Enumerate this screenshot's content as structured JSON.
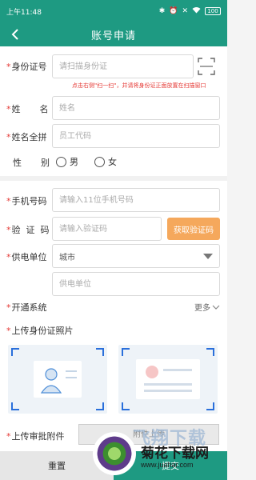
{
  "status_bar": {
    "time": "上午11:48",
    "battery": "100"
  },
  "nav": {
    "title": "账号申请"
  },
  "form": {
    "id_number": {
      "label": "身份证号",
      "placeholder": "请扫描身份证"
    },
    "scan_hint": "点击右侧\"扫一扫\"，并请将身份证正面放置在扫描窗口",
    "name": {
      "label_a": "姓",
      "label_b": "名",
      "placeholder": "姓名"
    },
    "pinyin": {
      "label": "姓名全拼",
      "placeholder": "员工代码"
    },
    "gender": {
      "label_a": "性",
      "label_b": "别",
      "options": [
        "男",
        "女"
      ]
    },
    "phone": {
      "label": "手机号码",
      "placeholder": "请输入11位手机号码"
    },
    "code": {
      "label_a": "验",
      "label_b": "证",
      "label_c": "码",
      "placeholder": "请输入验证码",
      "button": "获取验证码"
    },
    "supply_unit": {
      "label": "供电单位",
      "city_value": "城市",
      "unit_placeholder": "供电单位"
    },
    "systems": {
      "label": "开通系统",
      "more": "更多"
    },
    "id_photo": {
      "label": "上传身份证照片"
    },
    "approval": {
      "label": "上传审批附件",
      "button": "附件上传"
    }
  },
  "bottom": {
    "reset": "重置",
    "submit": "提交"
  },
  "watermark": {
    "ghost": "飞翔下载",
    "site": "菊花下载网",
    "url": "www.juahar.com"
  },
  "colors": {
    "primary": "#1e9a82",
    "required": "#e53935",
    "code_button": "#f5a85c",
    "frame": "#2a6fdb"
  }
}
